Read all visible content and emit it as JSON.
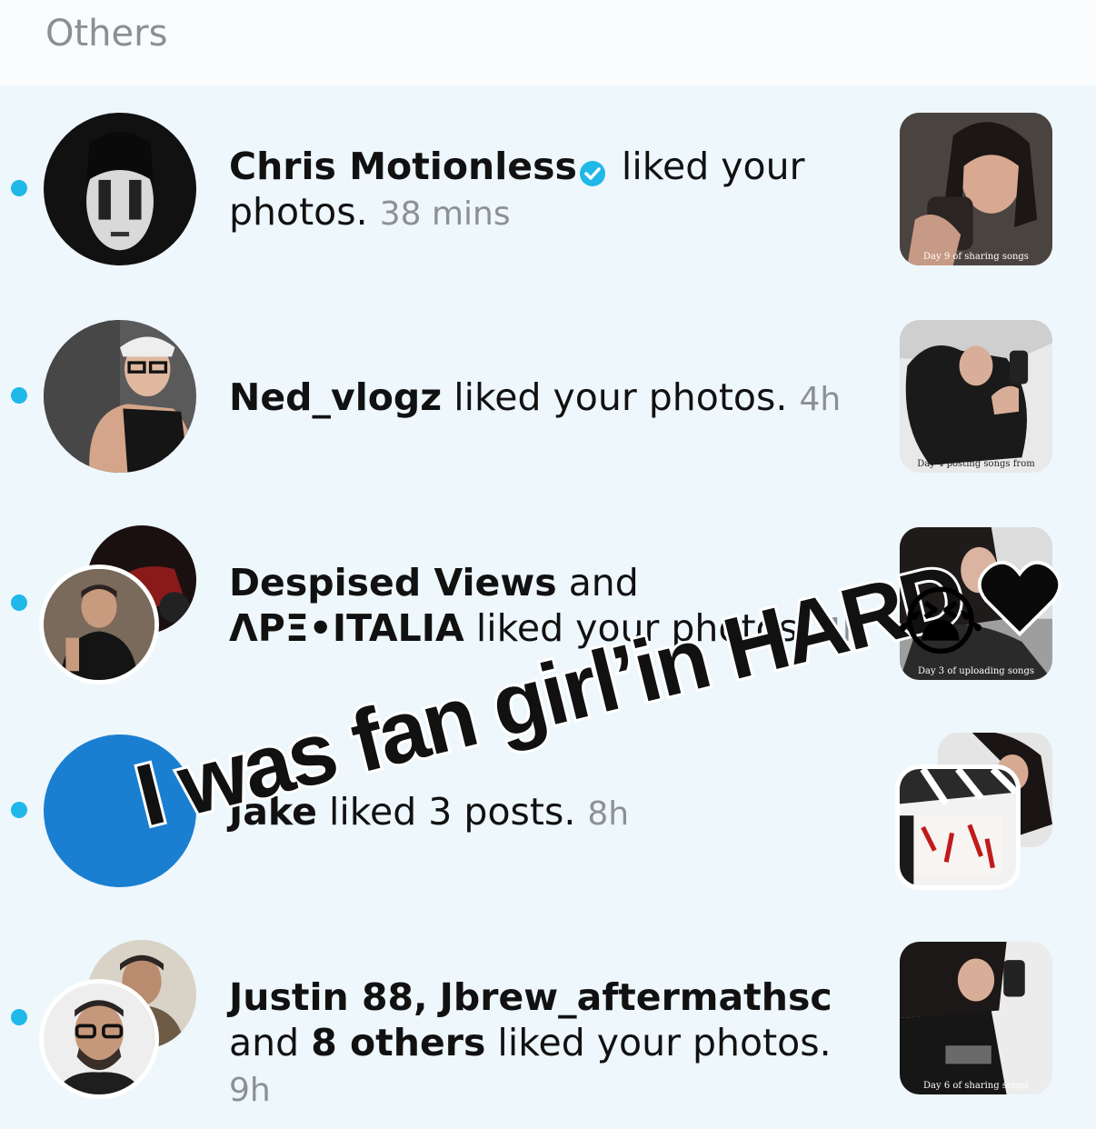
{
  "section": {
    "title": "Others"
  },
  "notifications": [
    {
      "unread": true,
      "actors": [
        "Chris Motionless"
      ],
      "verified": true,
      "action": "liked your photos.",
      "time": "38 mins",
      "thumb_caption": "Day 9 of sharing songs"
    },
    {
      "unread": true,
      "actors": [
        "Ned_vlogz"
      ],
      "action": "liked your photos.",
      "time": "4h",
      "thumb_caption": "Day 4 posting songs from"
    },
    {
      "unread": true,
      "actors": [
        "Despised Views",
        "ΛΡΞ•ITALIA"
      ],
      "joiner": "and",
      "action": "liked your photos.",
      "time": "4h",
      "thumb_caption": "Day 3 of uploading songs"
    },
    {
      "unread": true,
      "actors": [
        "Jake"
      ],
      "action": "liked 3 posts.",
      "time": "8h"
    },
    {
      "unread": true,
      "actors": [
        "Justin 88",
        "Jbrew_aftermathsc"
      ],
      "sep": ",",
      "joiner": "and",
      "others": "8 others",
      "action": "liked your photos.",
      "time": "9h",
      "thumb_caption": "Day 6 of sharing songs"
    }
  ],
  "overlay": {
    "text": "I was fan girl’in HARD",
    "emoji_crying": "😭",
    "heart_color": "#000000"
  },
  "colors": {
    "unread_dot": "#20b8e8",
    "list_bg": "#eef7fc",
    "verified": "#20b8e8"
  }
}
